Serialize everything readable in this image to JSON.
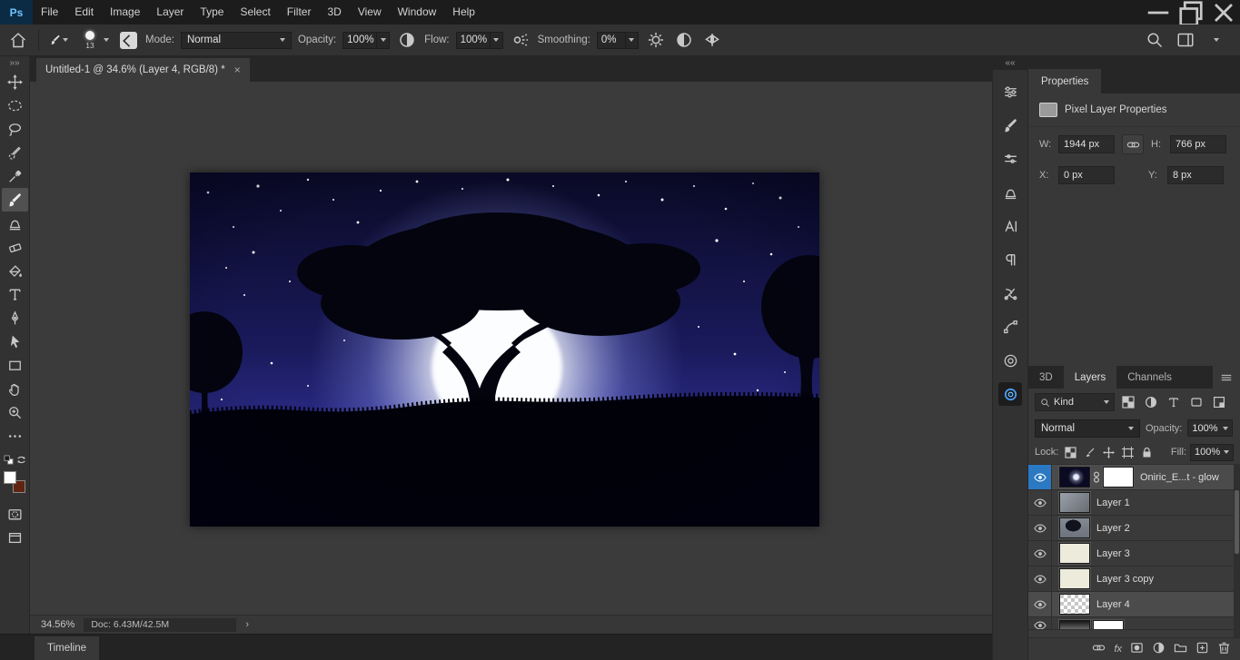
{
  "menu": {
    "logo": "Ps",
    "items": [
      "File",
      "Edit",
      "Image",
      "Layer",
      "Type",
      "Select",
      "Filter",
      "3D",
      "View",
      "Window",
      "Help"
    ]
  },
  "options": {
    "brush_size": "13",
    "mode_label": "Mode:",
    "mode_value": "Normal",
    "opacity_label": "Opacity:",
    "opacity_value": "100%",
    "flow_label": "Flow:",
    "flow_value": "100%",
    "smoothing_label": "Smoothing:",
    "smoothing_value": "0%"
  },
  "doc_tab": {
    "title": "Untitled-1 @ 34.6% (Layer 4, RGB/8) *",
    "close": "×"
  },
  "status": {
    "zoom": "34.56%",
    "doc": "Doc: 6.43M/42.5M",
    "chevron": "›"
  },
  "timeline": {
    "tab": "Timeline"
  },
  "properties": {
    "tab": "Properties",
    "header": "Pixel Layer Properties",
    "w_label": "W:",
    "w_value": "1944 px",
    "h_label": "H:",
    "h_value": "766 px",
    "x_label": "X:",
    "x_value": "0 px",
    "y_label": "Y:",
    "y_value": "8 px"
  },
  "layers": {
    "tabs": {
      "t3d": "3D",
      "layers": "Layers",
      "channels": "Channels"
    },
    "kind_label": "Kind",
    "blend_mode": "Normal",
    "opacity_label": "Opacity:",
    "opacity_value": "100%",
    "lock_label": "Lock:",
    "fill_label": "Fill:",
    "fill_value": "100%",
    "fx_label": "fx",
    "rows": [
      {
        "name": "Oniric_E...t - glow"
      },
      {
        "name": "Layer 1"
      },
      {
        "name": "Layer 2"
      },
      {
        "name": "Layer 3"
      },
      {
        "name": "Layer 3 copy"
      },
      {
        "name": "Layer 4"
      },
      {
        "name": ""
      }
    ]
  },
  "colors": {
    "logo_blue": "#6fc3ff",
    "selection_blue": "#2b79c2",
    "background_swatch": "#5f2412",
    "foreground_swatch": "#ffffff"
  }
}
